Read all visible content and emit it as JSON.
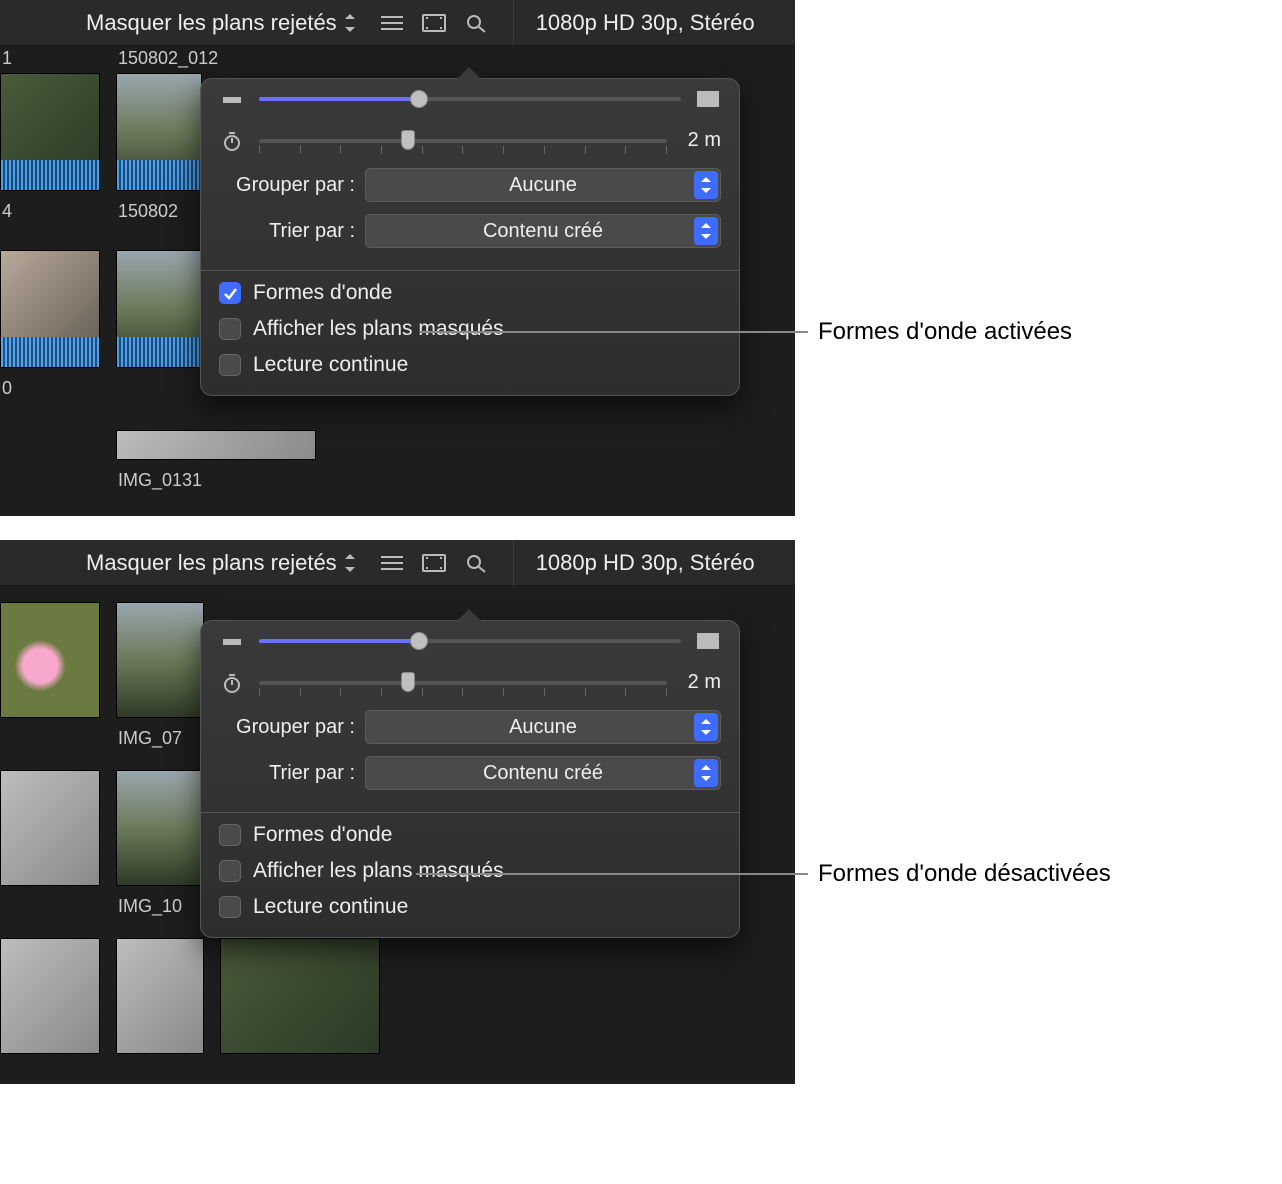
{
  "toolbar_a": {
    "filter_label": "Masquer les plans rejetés",
    "media_info": "1080p HD 30p, Stéréo"
  },
  "toolbar_b": {
    "filter_label": "Masquer les plans rejetés",
    "media_info": "1080p HD 30p, Stéréo"
  },
  "popover_a": {
    "duration_value": "2 m",
    "group_label": "Grouper par :",
    "group_value": "Aucune",
    "sort_label": "Trier par :",
    "sort_value": "Contenu créé",
    "opt_waveforms": "Formes d'onde",
    "opt_hidden": "Afficher les plans masqués",
    "opt_loop": "Lecture continue",
    "waveforms_checked": true
  },
  "popover_b": {
    "duration_value": "2 m",
    "group_label": "Grouper par :",
    "group_value": "Aucune",
    "sort_label": "Trier par :",
    "sort_value": "Contenu créé",
    "opt_waveforms": "Formes d'onde",
    "opt_hidden": "Afficher les plans masqués",
    "opt_loop": "Lecture continue",
    "waveforms_checked": false
  },
  "callouts": {
    "a": "Formes d'onde activées",
    "b": "Formes d'onde désactivées"
  },
  "clips_a": {
    "top_left": "1",
    "top_right": "150802_012",
    "mid_left": "4",
    "mid_right": "150802",
    "bot_left": "0",
    "bot_right": "IMG_0131"
  },
  "clips_b": {
    "r1c2": "IMG_07",
    "r2c2": "IMG_10"
  }
}
